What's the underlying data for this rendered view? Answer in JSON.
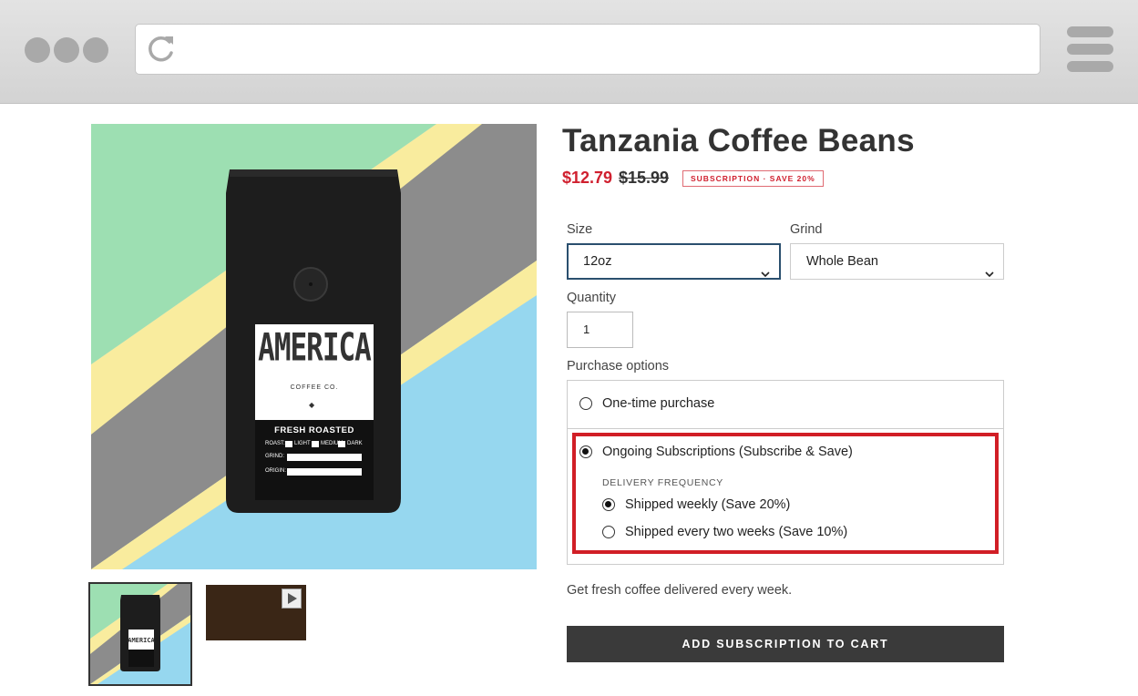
{
  "product": {
    "title": "Tanzania Coffee Beans",
    "price": "$12.79",
    "compare_price": "$15.99",
    "badge": "SUBSCRIPTION · SAVE 20%"
  },
  "bag_label": {
    "brand": "AMERICA",
    "brand_sub": "COFFEE CO.",
    "band": "FRESH ROASTED",
    "roast": "ROAST:",
    "roast_light": "LIGHT",
    "roast_medium": "MEDIUM",
    "roast_dark": "DARK",
    "grind": "GRIND:",
    "origin": "ORIGIN:"
  },
  "options": {
    "size_label": "Size",
    "size_value": "12oz",
    "grind_label": "Grind",
    "grind_value": "Whole Bean",
    "quantity_label": "Quantity",
    "quantity_value": "1",
    "purchase_label": "Purchase options"
  },
  "purchase": {
    "one_time": "One-time purchase",
    "subscription": "Ongoing Subscriptions (Subscribe & Save)",
    "frequency_label": "DELIVERY FREQUENCY",
    "weekly": "Shipped weekly (Save 20%)",
    "biweekly": "Shipped every two weeks (Save 10%)",
    "selected_plan": "subscription",
    "selected_frequency": "weekly"
  },
  "description": "Get fresh coffee delivered every week.",
  "cta_label": "ADD SUBSCRIPTION TO CART",
  "colors": {
    "sale_red": "#d0202f",
    "highlight_red": "#d11e26",
    "select_focus": "#2a4f6e",
    "button_dark": "#3a3a3a",
    "flag_green": "#9ddfb2",
    "flag_yellow": "#f9ec9e",
    "flag_gray": "#8c8c8c",
    "flag_blue": "#96d7ef"
  },
  "icons": {
    "reload": "reload-icon",
    "menu": "hamburger-menu-icon",
    "chevron": "chevron-down-icon",
    "play": "play-icon"
  }
}
